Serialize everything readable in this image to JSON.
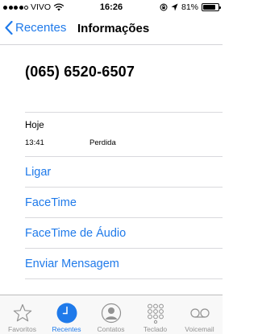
{
  "status_bar": {
    "carrier": "VIVO",
    "time": "16:26",
    "battery_percent": "81%",
    "battery_level": 0.81,
    "signal_bars_filled": 4
  },
  "nav": {
    "back_label": "Recentes",
    "title": "Informações"
  },
  "contact": {
    "phone_number": "(065) 6520-6507"
  },
  "recent_call": {
    "day": "Hoje",
    "time": "13:41",
    "status": "Perdida"
  },
  "actions": {
    "call": "Ligar",
    "facetime": "FaceTime",
    "facetime_audio": "FaceTime de Áudio",
    "send_message": "Enviar Mensagem"
  },
  "tabs": [
    {
      "label": "Favoritos",
      "icon": "star-icon",
      "active": false
    },
    {
      "label": "Recentes",
      "icon": "clock-icon",
      "active": true
    },
    {
      "label": "Contatos",
      "icon": "contacts-icon",
      "active": false
    },
    {
      "label": "Teclado",
      "icon": "keypad-icon",
      "active": false
    },
    {
      "label": "Voicemail",
      "icon": "voicemail-icon",
      "active": false
    }
  ],
  "colors": {
    "accent": "#1f7aea",
    "inactive_tab": "#929292",
    "separator": "#d9d9dd"
  }
}
